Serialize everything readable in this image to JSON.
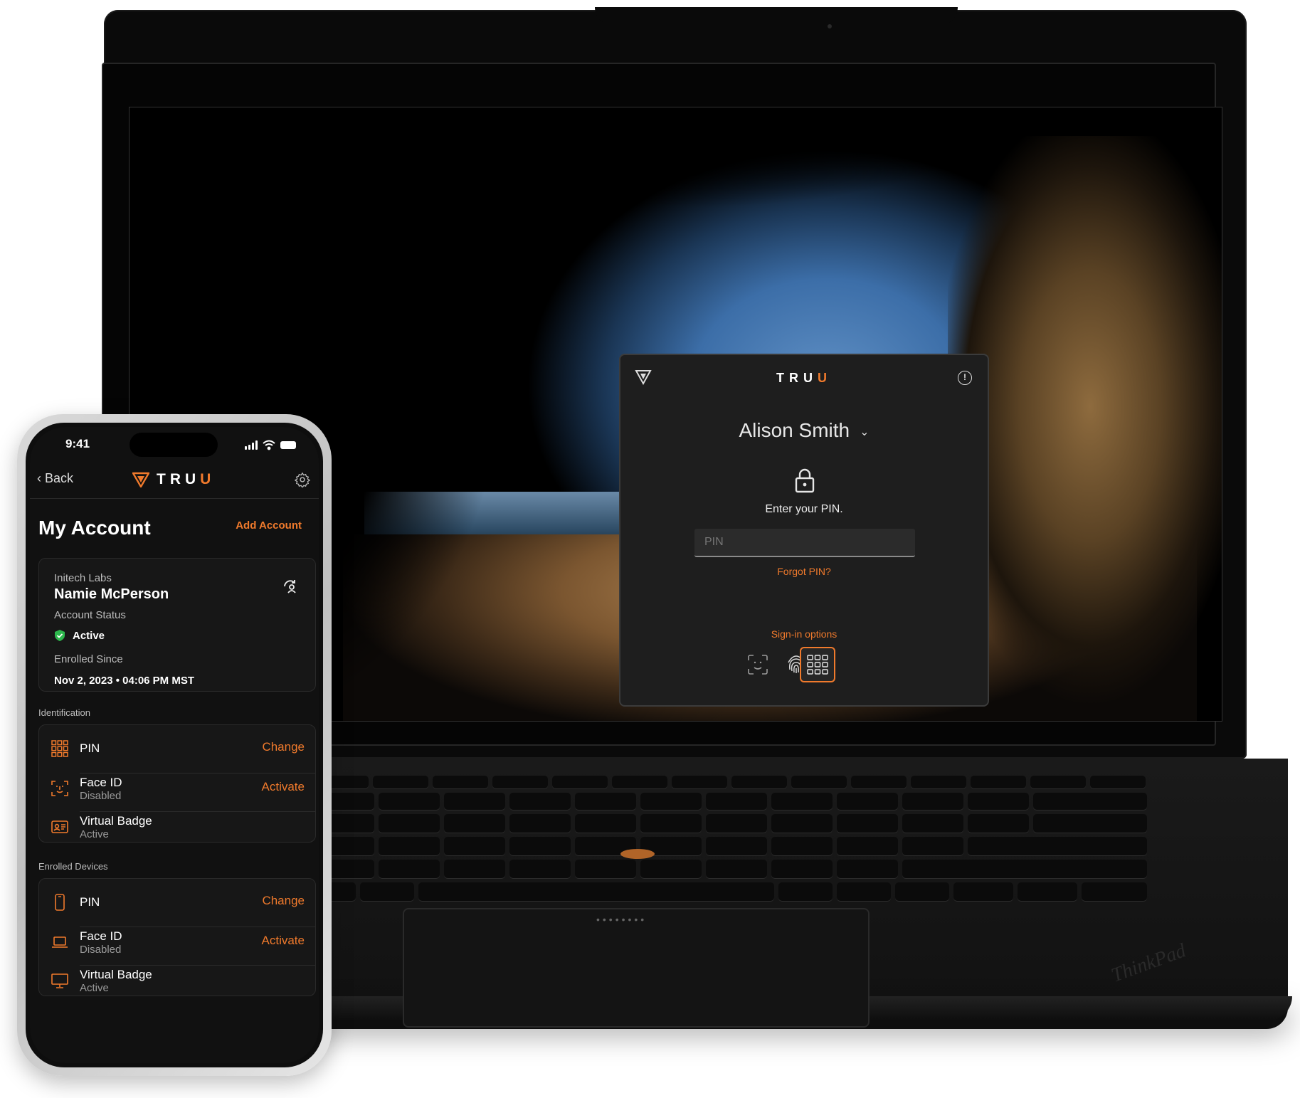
{
  "dialog": {
    "brand": "TRU",
    "brand_accent": "U",
    "user_name": "Alison Smith",
    "prompt": "Enter your PIN.",
    "pin_placeholder": "PIN",
    "forgot_label": "Forgot PIN?",
    "signin_options_label": "Sign-in options",
    "options": [
      "face-scan-icon",
      "fingerprint-icon",
      "pin-keypad-icon"
    ],
    "selected_option": "pin-keypad-icon"
  },
  "phone": {
    "status": {
      "time": "9:41"
    },
    "nav": {
      "back_label": "Back",
      "brand": "TRU",
      "brand_accent": "U"
    },
    "title": "My Account",
    "add_account_label": "Add Account",
    "account": {
      "org": "Initech Labs",
      "name": "Namie McPerson",
      "status_label": "Account Status",
      "status": "Active",
      "enrolled_label": "Enrolled Since",
      "enrolled": "Nov 2, 2023 • 04:06 PM MST"
    },
    "identification": {
      "label": "Identification",
      "items": [
        {
          "name": "PIN",
          "sub": "",
          "action": "Change",
          "icon": "keypad-icon"
        },
        {
          "name": "Face ID",
          "sub": "Disabled",
          "action": "Activate",
          "icon": "face-id-icon"
        },
        {
          "name": "Virtual Badge",
          "sub": "Active",
          "action": "",
          "icon": "badge-icon"
        }
      ]
    },
    "devices": {
      "label": "Enrolled Devices",
      "items": [
        {
          "name": "PIN",
          "sub": "",
          "action": "Change",
          "icon": "phone-icon"
        },
        {
          "name": "Face ID",
          "sub": "Disabled",
          "action": "Activate",
          "icon": "laptop-icon"
        },
        {
          "name": "Virtual Badge",
          "sub": "Active",
          "action": "",
          "icon": "desktop-icon"
        }
      ]
    }
  },
  "laptop": {
    "brand": "ThinkPad"
  },
  "colors": {
    "accent": "#f07a2c",
    "status_green": "#2db84d",
    "dialog_bg": "#1e1e1e",
    "phone_bg": "#111111"
  }
}
